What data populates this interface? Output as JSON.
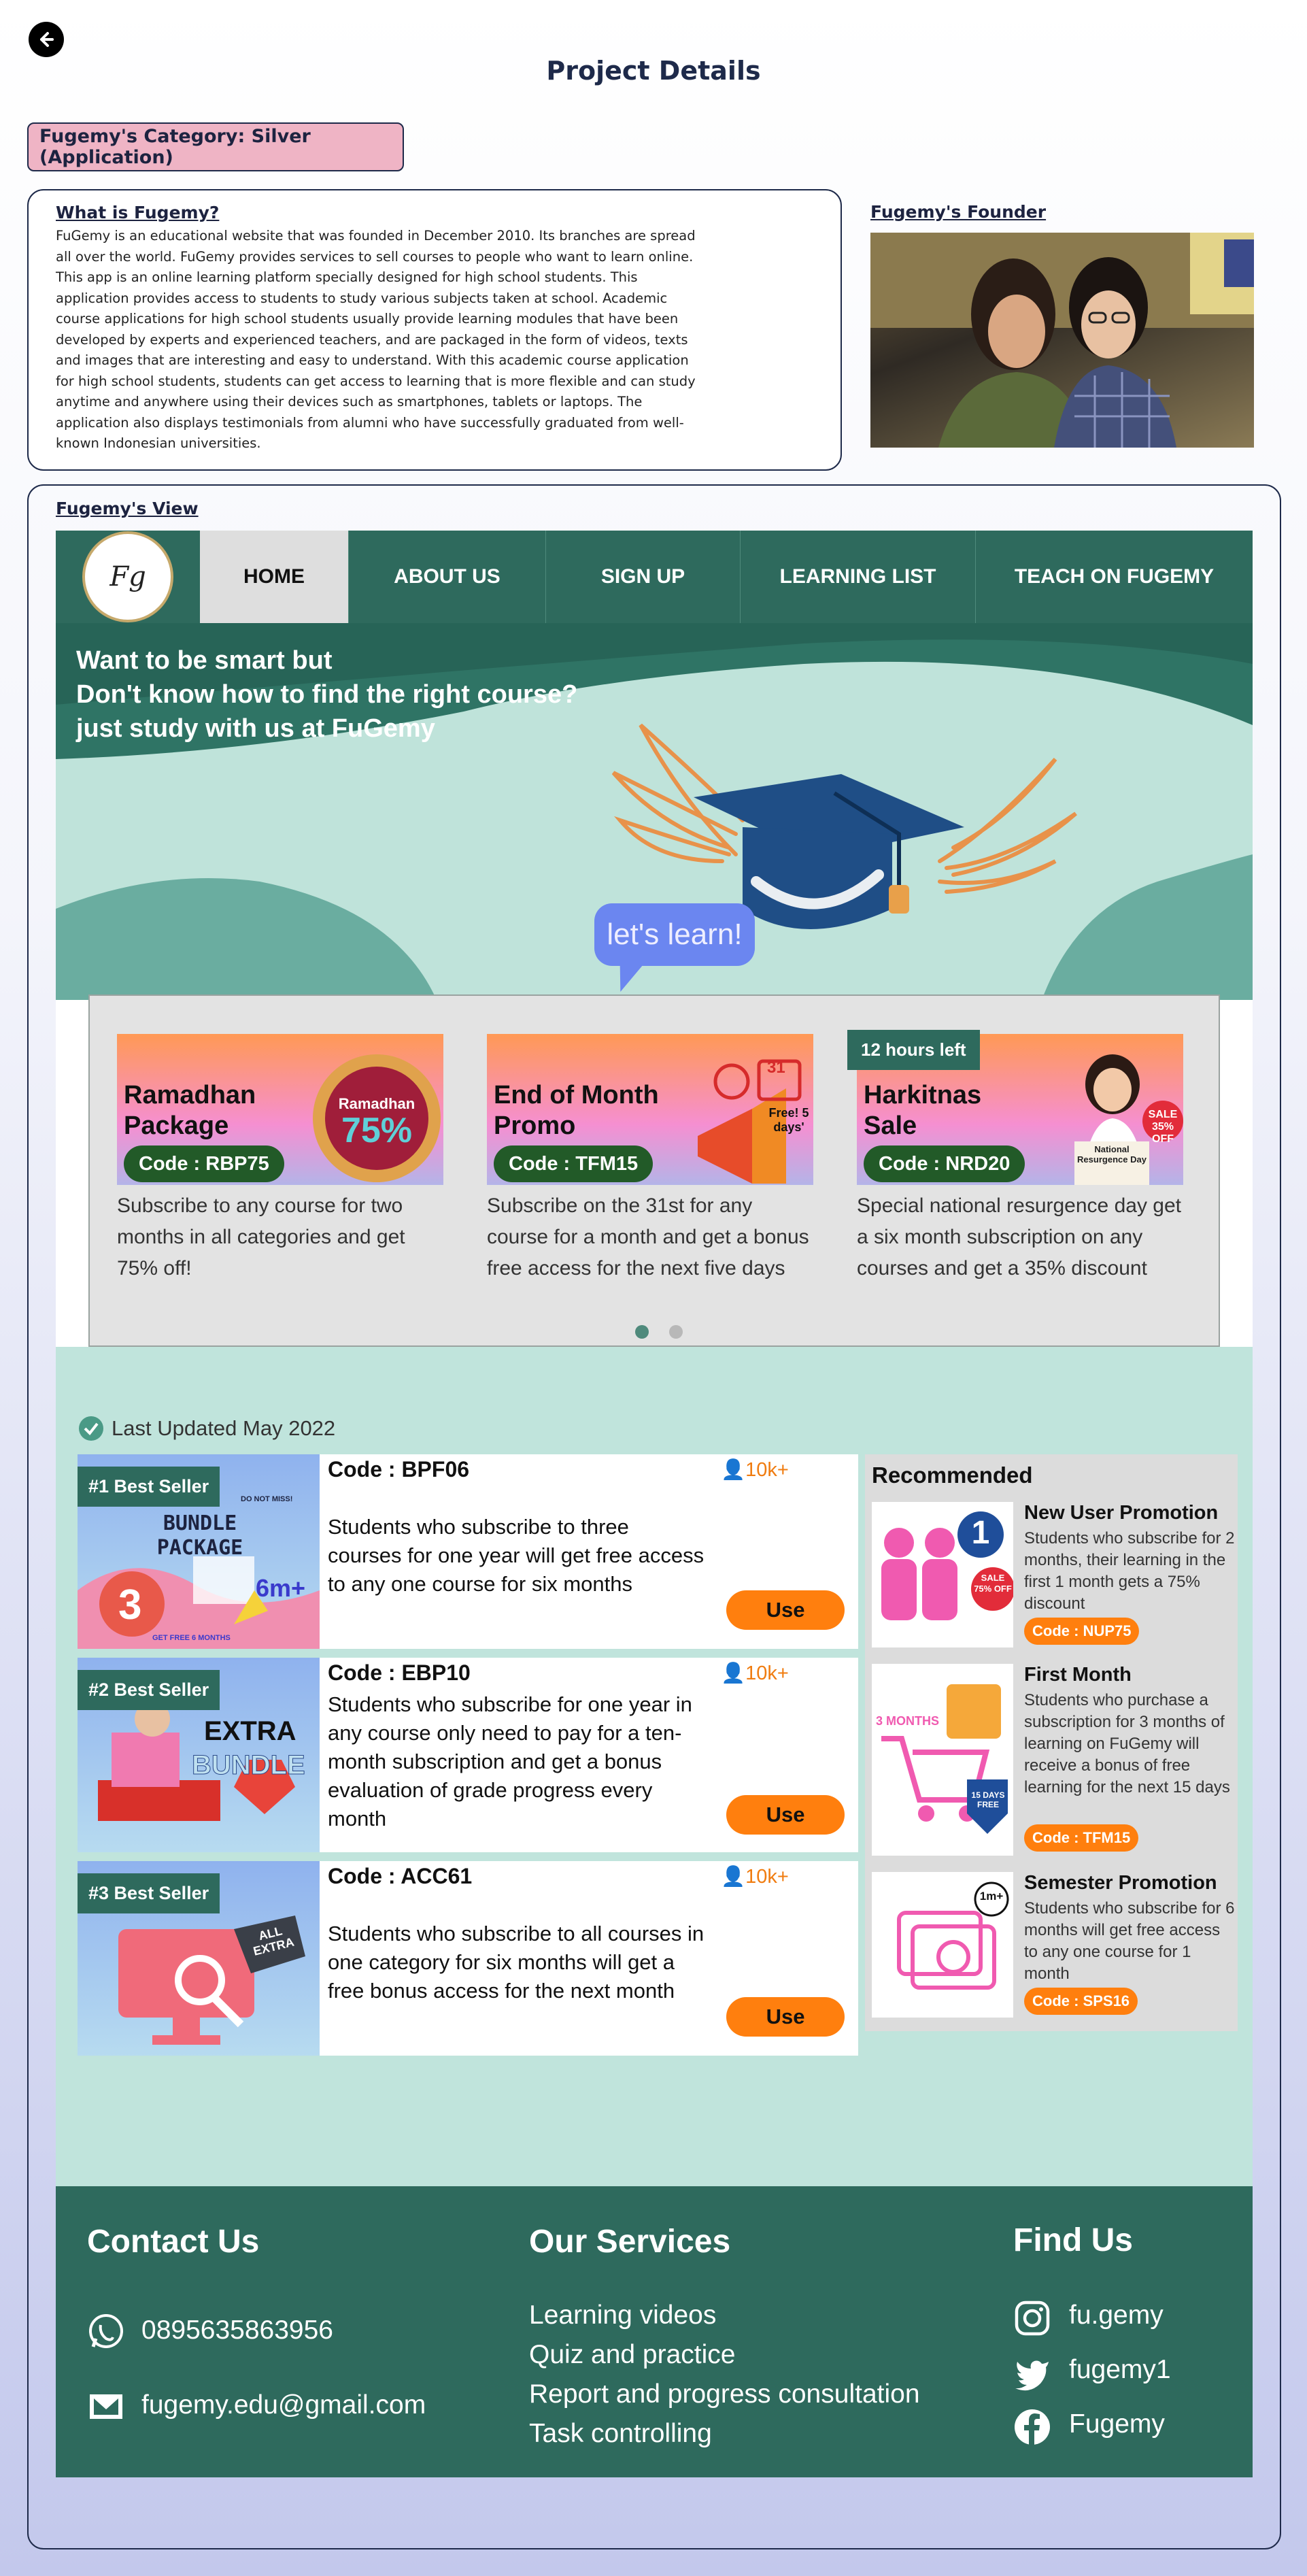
{
  "header": {
    "title": "Project Details",
    "back_label": "back"
  },
  "category": "Fugemy's Category: Silver (Application)",
  "about": {
    "heading": "What is Fugemy?",
    "lines": [
      "FuGemy is an educational website that was founded in December 2010. Its branches are spread",
      "all over the world. FuGemy provides services to sell courses to people who want to learn online.",
      "This app is an online learning platform specially designed for high school students. This",
      "application provides access to students to study various subjects taken at school. Academic",
      "course applications for high school students usually provide learning modules that have been",
      "developed by experts and experienced teachers, and are packaged in the form of videos, texts",
      "and images that are interesting and easy to understand. With this academic course application",
      "for high school students, students can get access to learning that is more flexible and can study",
      "anytime and anywhere using their devices such as smartphones, tablets or laptops. The",
      "application also displays testimonials from alumni who have successfully graduated from well-",
      "known Indonesian universities."
    ]
  },
  "founder": {
    "heading": "Fugemy's Founder"
  },
  "view": {
    "heading": "Fugemy's View"
  },
  "site": {
    "logo_text": "Fg",
    "nav": [
      "HOME",
      "ABOUT US",
      "SIGN UP",
      "LEARNING LIST",
      "TEACH ON FUGEMY"
    ],
    "hero": {
      "lines": [
        "Want to be smart but",
        "Don't know how to find the right course?",
        "just study with us at FuGemy"
      ],
      "bubble": "let's learn!"
    },
    "promos": [
      {
        "name": "Ramadhan Package",
        "code": "Code : RBP75",
        "desc": "Subscribe to any course for two months in all categories and get 75% off!",
        "art_title": "Ramadhan",
        "art_value": "75%"
      },
      {
        "name": "End of Month Promo",
        "code": "Code : TFM15",
        "desc": "Subscribe on the 31st for any course for a month and get a bonus free access for the next five days",
        "art_label": "Free! 5 days'",
        "art_date": "31"
      },
      {
        "name": "Harkitnas Sale",
        "code": "Code : NRD20",
        "desc": "Special national resurgence day get a six month subscription on any courses and get a 35% discount",
        "timer": "12 hours left",
        "art_sale": "SALE 35% OFF",
        "art_sign": "National Resurgence Day"
      }
    ],
    "updated": "Last  Updated May 2022",
    "bestsellers": [
      {
        "badge": "#1 Best Seller",
        "code": "Code : BPF06",
        "count": "10k+",
        "desc": "Students who subscribe to three courses for one year will get free access to any one course for six months",
        "use": "Use",
        "art_top": "BUNDLE PACKAGE",
        "art_note": "DO NOT MISS!",
        "art_big": "3",
        "art_plus": "6m+",
        "art_foot": "GET FREE 6 MONTHS"
      },
      {
        "badge": "#2 Best Seller",
        "code": "Code : EBP10",
        "count": "10k+",
        "desc": "Students who subscribe for one year in any course only need to pay for a ten-month subscription and get a bonus evaluation of grade progress every month",
        "use": "Use",
        "art_top": "EXTRA",
        "art_big": "BUNDLE"
      },
      {
        "badge": "#3 Best Seller",
        "code": "Code : ACC61",
        "count": "10k+",
        "desc": "Students who subscribe to all courses in one category for six months will get a free bonus access for the next month",
        "use": "Use",
        "art_tag": "ALL EXTRA"
      }
    ],
    "recommended": {
      "title": "Recommended",
      "items": [
        {
          "name": "New User Promotion",
          "desc": "Students who subscribe for 2 months, their learning in the first 1 month gets a 75% discount",
          "code": "Code : NUP75",
          "art_num": "1",
          "art_sale": "SALE 75% OFF"
        },
        {
          "name": "First Month",
          "desc": "Students who purchase a subscription for 3 months of learning on FuGemy will receive a bonus of free learning for the next 15 days",
          "code": "Code : TFM15",
          "art_label": "3 MONTHS",
          "art_free": "15 DAYS FREE"
        },
        {
          "name": "Semester Promotion",
          "desc": "Students who subscribe for 6 months will get free access to any one course for 1 month",
          "code": "Code : SPS16",
          "art_label": "1m+"
        }
      ]
    },
    "footer": {
      "contact": {
        "heading": "Contact Us",
        "phone": "0895635863956",
        "email": "fugemy.edu@gmail.com"
      },
      "services": {
        "heading": "Our Services",
        "items": [
          "Learning videos",
          "Quiz and practice",
          "Report and progress consultation",
          "Task controlling"
        ]
      },
      "find": {
        "heading": "Find Us",
        "instagram": "fu.gemy",
        "twitter": "fugemy1",
        "facebook": "Fugemy"
      }
    }
  },
  "colors": {
    "brand_green": "#2e6a5d",
    "accent_orange": "#ff7f0e",
    "code_green": "#225a28",
    "mint": "#c0e4dc"
  }
}
